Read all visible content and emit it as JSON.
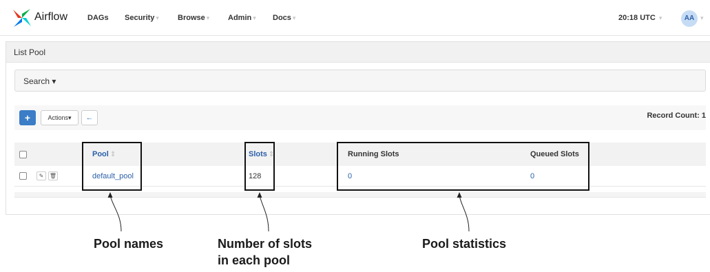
{
  "navbar": {
    "brand": "Airflow",
    "items": [
      {
        "label": "DAGs",
        "has_caret": false
      },
      {
        "label": "Security",
        "has_caret": true
      },
      {
        "label": "Browse",
        "has_caret": true
      },
      {
        "label": "Admin",
        "has_caret": true
      },
      {
        "label": "Docs",
        "has_caret": true
      }
    ],
    "time": "20:18 UTC",
    "user_initials": "AA",
    "caret": "▾"
  },
  "panel": {
    "title": "List Pool",
    "search_label": "Search ▾",
    "toolbar": {
      "add_label": "+",
      "actions_label": "Actions▾",
      "back_label": "←",
      "record_count": "Record Count: 1"
    }
  },
  "table": {
    "columns": {
      "pool": "Pool",
      "slots": "Slots",
      "running": "Running Slots",
      "queued": "Queued Slots"
    },
    "rows": [
      {
        "pool": "default_pool",
        "slots": "128",
        "running": "0",
        "queued": "0"
      }
    ]
  },
  "annotations": {
    "pool_names": "Pool names",
    "slots_line1": "Number of slots",
    "slots_line2": "in each pool",
    "pool_stats": "Pool statistics"
  },
  "colors": {
    "accent": "#3b7dc6",
    "link": "#2a5fa8",
    "avatar_bg": "#c6dcf5"
  }
}
